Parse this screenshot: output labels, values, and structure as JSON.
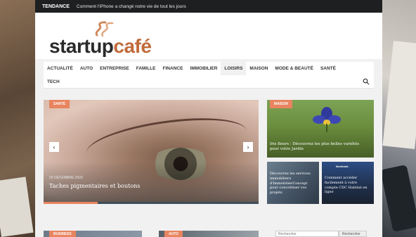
{
  "trending": {
    "label": "TENDANCE",
    "headline": "Comment l'iPhone a changé notre vie de tout les jours"
  },
  "logo": {
    "part1": "startup",
    "part2": "café",
    "brand_dark": "#2a2a2a",
    "brand_accent": "#c06b3a"
  },
  "nav": {
    "items": [
      "ACTUALITÉ",
      "AUTO",
      "ENTREPRISE",
      "FAMILLE",
      "FINANCE",
      "IMMOBILIER",
      "LOISIRS",
      "MAISON",
      "MODE & BEAUTÉ",
      "SANTÉ",
      "TECH"
    ],
    "active_index": 6,
    "search_icon": "search-icon"
  },
  "slider": {
    "badge": "SANTÉ",
    "date": "25 DÉCEMBRE 2023",
    "title": "Taches pigmentaires et boutons",
    "prev_icon": "chevron-left-icon",
    "next_icon": "chevron-right-icon",
    "progress": 0.25
  },
  "cards": {
    "big": {
      "badge": "MAISON",
      "title": "Iris fleurs : Découvrez les plus belles variétés pour votre Jardin"
    },
    "small1": {
      "title": "Découvrez les services immobiliers d'ImmobilierConcept pour concrétiser vos projets"
    },
    "small2": {
      "image_text": "facebook",
      "title": "Comment accéder facilement à votre compte CDC Habitat en ligne"
    }
  },
  "bottom": {
    "badge1": "BUSINESS",
    "badge2": "AUTO",
    "search_placeholder": "Rechercher",
    "search_button": "Rechercher"
  },
  "colors": {
    "accent": "#e8845f",
    "dark_bar": "#1d1f20"
  }
}
